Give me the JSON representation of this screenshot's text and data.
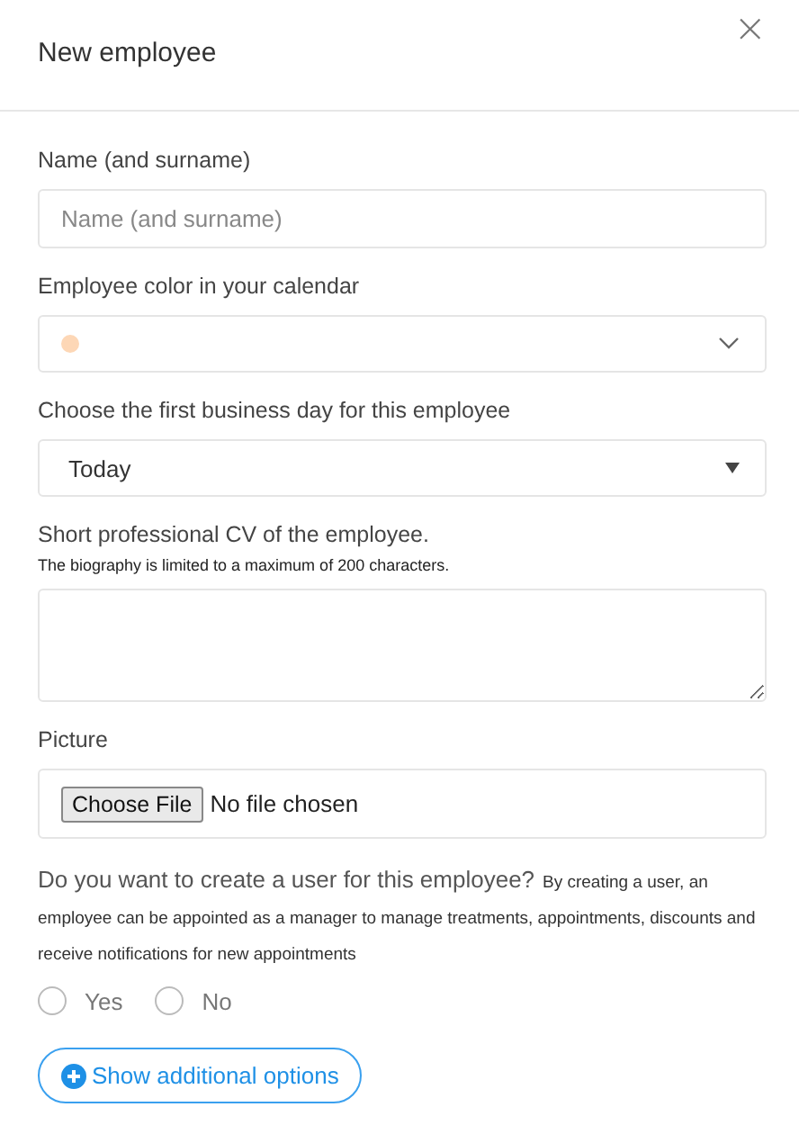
{
  "dialog": {
    "title": "New employee",
    "close": "×"
  },
  "fields": [
    {
      "kind": "text",
      "label": "Name (and surname)",
      "placeholder": "Name (and surname)"
    },
    {
      "kind": "color",
      "label": "Employee color in your calendar",
      "color": "#fdd7b6"
    },
    {
      "kind": "select",
      "label": "Choose the first business day for this employee",
      "value": "Today"
    },
    {
      "kind": "textarea",
      "label": "Short professional CV of the employee.",
      "hint": "The biography is limited to a maximum of 200 characters."
    },
    {
      "kind": "file",
      "label": "Picture",
      "button": "Choose File",
      "status": "No file chosen"
    }
  ],
  "user_question": {
    "question": "Do you want to create a user for this employee?",
    "note": "By creating a user, an employee can be appointed as a manager to manage treatments, appointments, discounts and receive notifications for new appointments",
    "options": [
      {
        "label": "Yes",
        "selected": false
      },
      {
        "label": "No",
        "selected": false
      }
    ]
  },
  "more_button": "Show additional options"
}
